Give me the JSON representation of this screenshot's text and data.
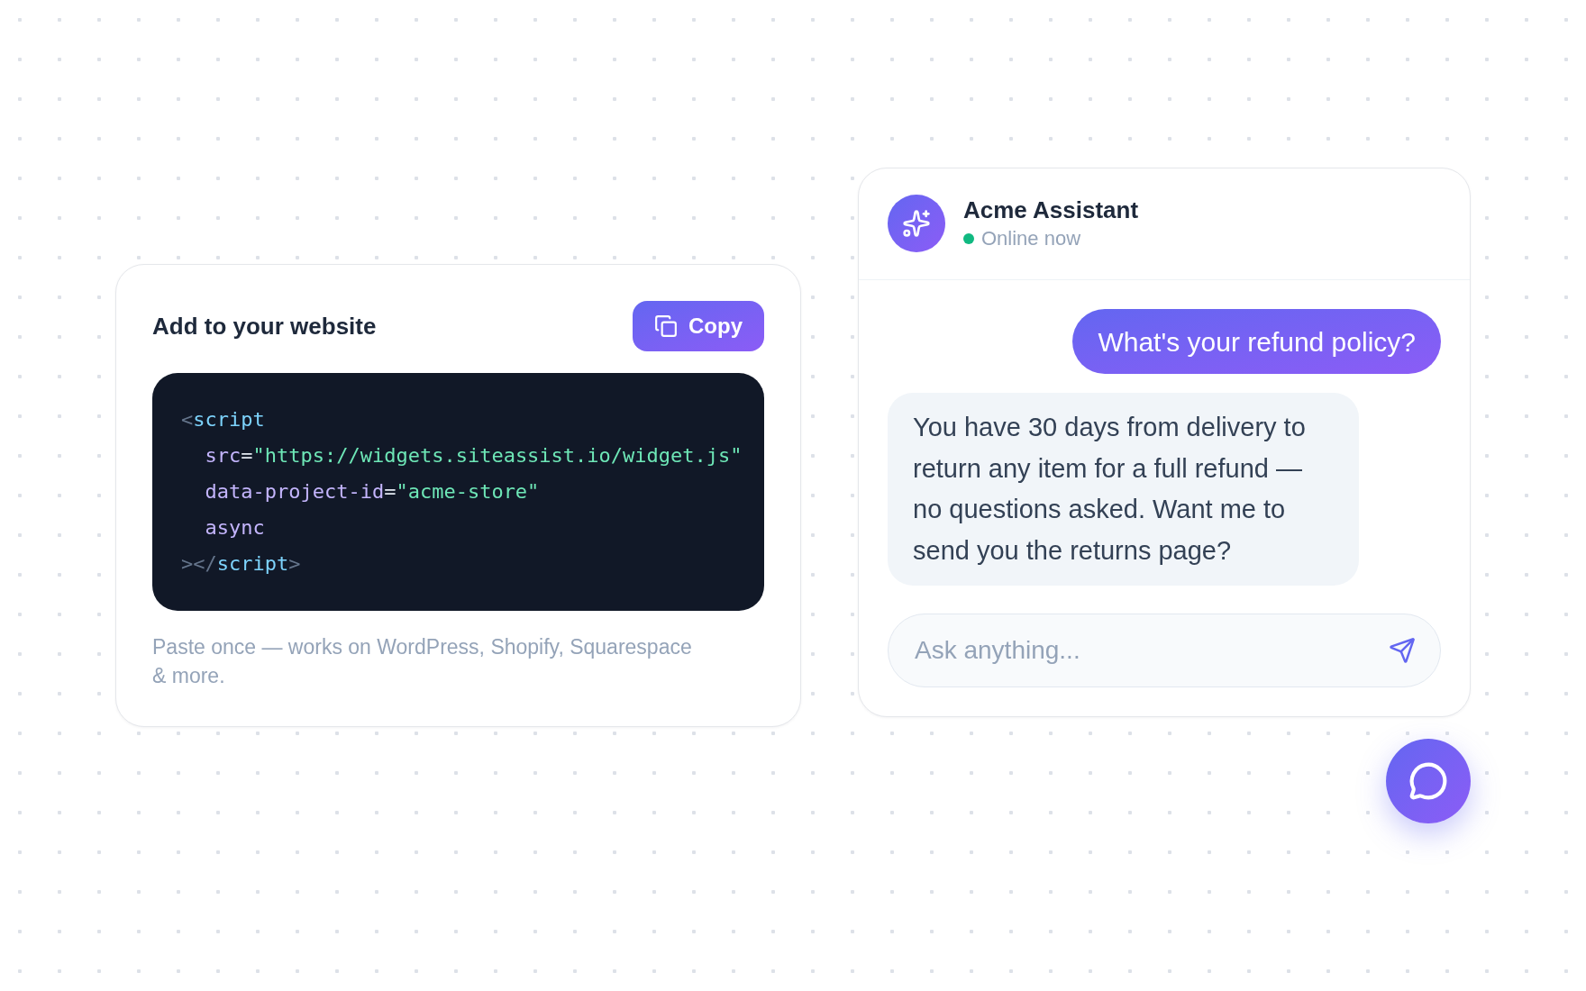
{
  "embed_card": {
    "title": "Add to your website",
    "copy_button": "Copy",
    "code": {
      "lines": [
        {
          "tokens": [
            {
              "kind": "punct",
              "text": "<"
            },
            {
              "kind": "tag",
              "text": "script"
            }
          ],
          "children": [
            {
              "tokens": [
                {
                  "kind": "attr",
                  "text": "src"
                },
                {
                  "kind": "operator",
                  "text": "="
                },
                {
                  "kind": "string",
                  "text": "\"https://widgets.siteassist.io/widget.js\""
                }
              ]
            },
            {
              "tokens": [
                {
                  "kind": "attr",
                  "text": "data-project-id"
                },
                {
                  "kind": "operator",
                  "text": "="
                },
                {
                  "kind": "string",
                  "text": "\"acme-store\""
                }
              ]
            },
            {
              "tokens": [
                {
                  "kind": "attr",
                  "text": "async"
                }
              ]
            }
          ]
        },
        {
          "tokens": [
            {
              "kind": "punct",
              "text": "></"
            },
            {
              "kind": "tag",
              "text": "script"
            },
            {
              "kind": "punct",
              "text": ">"
            }
          ]
        }
      ]
    },
    "note": "Paste once — works on WordPress, Shopify, Squarespace & more."
  },
  "chat_widget": {
    "assistant_name": "Acme Assistant",
    "status": {
      "label": "Online now",
      "online": true
    },
    "messages": [
      {
        "kind": "user",
        "text": "What's your refund policy?"
      },
      {
        "kind": "assistant",
        "text": "You have 30 days from delivery to return any item for a full refund — no questions asked. Want me to send you the returns page?"
      }
    ],
    "input": {
      "placeholder": "Ask anything..."
    }
  }
}
